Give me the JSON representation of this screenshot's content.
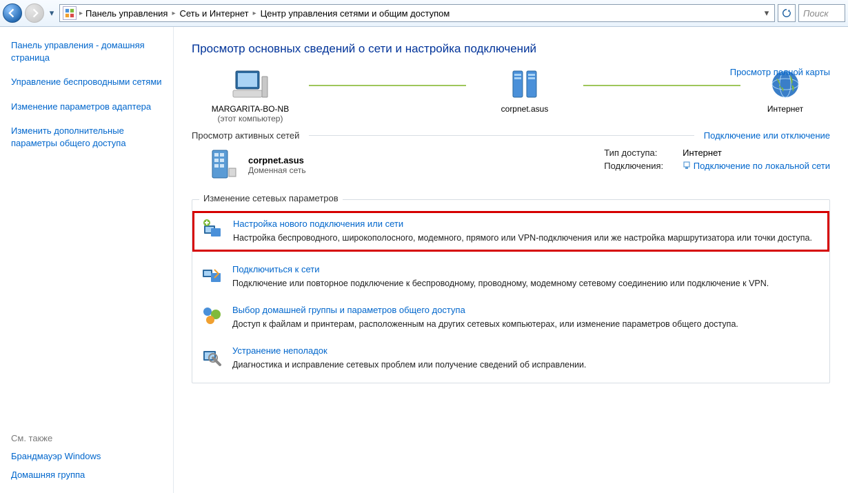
{
  "breadcrumbs": [
    "Панель управления",
    "Сеть и Интернет",
    "Центр управления сетями и общим доступом"
  ],
  "search_placeholder": "Поиск",
  "sidebar": {
    "home": "Панель управления - домашняя страница",
    "links": [
      "Управление беспроводными сетями",
      "Изменение параметров адаптера",
      "Изменить дополнительные параметры общего доступа"
    ],
    "see_also_label": "См. также",
    "see_also": [
      "Брандмауэр Windows",
      "Домашняя группа"
    ]
  },
  "heading": "Просмотр основных сведений о сети и настройка подключений",
  "map_link": "Просмотр полной карты",
  "nodes": {
    "pc_name": "MARGARITA-BO-NB",
    "pc_sub": "(этот компьютер)",
    "net_name": "corpnet.asus",
    "inet_name": "Интернет"
  },
  "active_section": "Просмотр активных сетей",
  "active_toggle": "Подключение или отключение",
  "active": {
    "name": "corpnet.asus",
    "type": "Доменная сеть",
    "access_label": "Тип доступа:",
    "access_value": "Интернет",
    "conn_label": "Подключения:",
    "conn_value": "Подключение по локальной сети"
  },
  "change_section": "Изменение сетевых параметров",
  "tasks": [
    {
      "title": "Настройка нового подключения или сети",
      "desc": "Настройка беспроводного, широкополосного, модемного, прямого или VPN-подключения или же настройка маршрутизатора или точки доступа.",
      "highlight": true
    },
    {
      "title": "Подключиться к сети",
      "desc": "Подключение или повторное подключение к беспроводному, проводному, модемному сетевому соединению или подключение к VPN.",
      "highlight": false
    },
    {
      "title": "Выбор домашней группы и параметров общего доступа",
      "desc": "Доступ к файлам и принтерам, расположенным на других сетевых компьютерах, или изменение параметров общего доступа.",
      "highlight": false
    },
    {
      "title": "Устранение неполадок",
      "desc": "Диагностика и исправление сетевых проблем или получение сведений об исправлении.",
      "highlight": false
    }
  ]
}
